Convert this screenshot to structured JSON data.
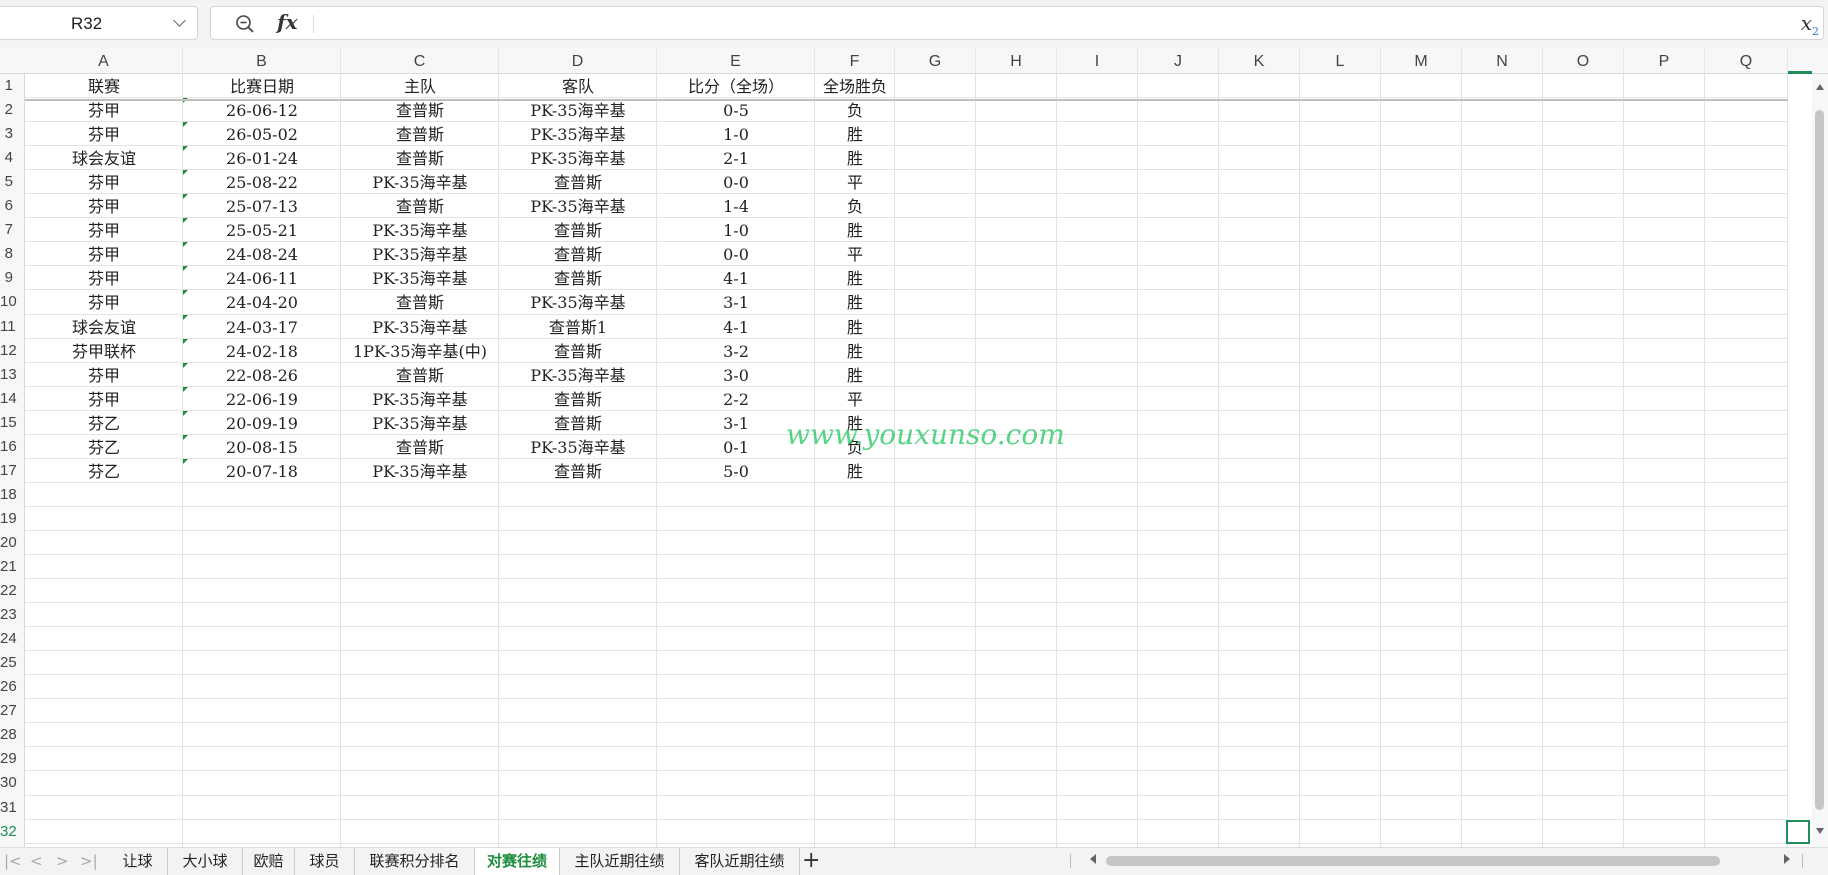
{
  "formula_bar": {
    "name_box": "R32",
    "fx_label": "fx",
    "formula_value": ""
  },
  "columns": [
    "A",
    "B",
    "C",
    "D",
    "E",
    "F",
    "G",
    "H",
    "I",
    "J",
    "K",
    "L",
    "M",
    "N",
    "O",
    "P",
    "Q"
  ],
  "rows": [
    "1",
    "2",
    "3",
    "4",
    "5",
    "6",
    "7",
    "8",
    "9",
    "10",
    "11",
    "12",
    "13",
    "14",
    "15",
    "16",
    "17",
    "18",
    "19",
    "20",
    "21",
    "22",
    "23",
    "24",
    "25",
    "26",
    "27",
    "28",
    "29",
    "30",
    "31",
    "32"
  ],
  "active_row": "32",
  "table": {
    "headers": [
      "联赛",
      "比赛日期",
      "主队",
      "客队",
      "比分（全场）",
      "全场胜负"
    ],
    "rows": [
      [
        "芬甲",
        "26-06-12",
        "查普斯",
        "PK-35海辛基",
        "0-5",
        "负"
      ],
      [
        "芬甲",
        "26-05-02",
        "查普斯",
        "PK-35海辛基",
        "1-0",
        "胜"
      ],
      [
        "球会友谊",
        "26-01-24",
        "查普斯",
        "PK-35海辛基",
        "2-1",
        "胜"
      ],
      [
        "芬甲",
        "25-08-22",
        "PK-35海辛基",
        "查普斯",
        "0-0",
        "平"
      ],
      [
        "芬甲",
        "25-07-13",
        "查普斯",
        "PK-35海辛基",
        "1-4",
        "负"
      ],
      [
        "芬甲",
        "25-05-21",
        "PK-35海辛基",
        "查普斯",
        "1-0",
        "胜"
      ],
      [
        "芬甲",
        "24-08-24",
        "PK-35海辛基",
        "查普斯",
        "0-0",
        "平"
      ],
      [
        "芬甲",
        "24-06-11",
        "PK-35海辛基",
        "查普斯",
        "4-1",
        "胜"
      ],
      [
        "芬甲",
        "24-04-20",
        "查普斯",
        "PK-35海辛基",
        "3-1",
        "胜"
      ],
      [
        "球会友谊",
        "24-03-17",
        "PK-35海辛基",
        "查普斯1",
        "4-1",
        "胜"
      ],
      [
        "芬甲联杯",
        "24-02-18",
        "1PK-35海辛基(中)",
        "查普斯",
        "3-2",
        "胜"
      ],
      [
        "芬甲",
        "22-08-26",
        "查普斯",
        "PK-35海辛基",
        "3-0",
        "胜"
      ],
      [
        "芬甲",
        "22-06-19",
        "PK-35海辛基",
        "查普斯",
        "2-2",
        "平"
      ],
      [
        "芬乙",
        "20-09-19",
        "PK-35海辛基",
        "查普斯",
        "3-1",
        "胜"
      ],
      [
        "芬乙",
        "20-08-15",
        "查普斯",
        "PK-35海辛基",
        "0-1",
        "负"
      ],
      [
        "芬乙",
        "20-07-18",
        "PK-35海辛基",
        "查普斯",
        "5-0",
        "胜"
      ]
    ]
  },
  "watermark": "www.youxunso.com",
  "sheet_tabs": [
    "让球",
    "大小球",
    "欧赔",
    "球员",
    "联赛积分排名",
    "对赛往绩",
    "主队近期往绩",
    "客队近期往绩"
  ],
  "active_tab": "对赛往绩",
  "add_tab_label": "+",
  "colors": {
    "accent": "#1e8e3e",
    "grid": "#e3e3e3",
    "watermark": "#22c55e"
  }
}
